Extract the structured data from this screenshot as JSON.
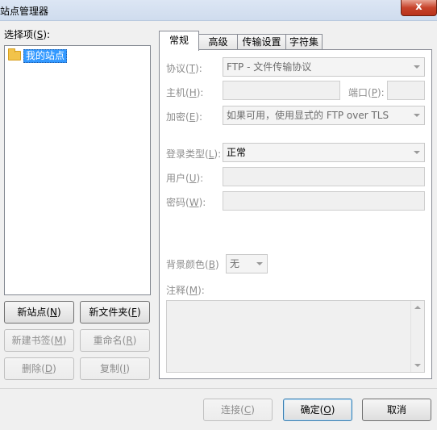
{
  "window": {
    "title": "站点管理器",
    "close": "x"
  },
  "left": {
    "select_label": "选择项",
    "select_key": "S",
    "tree_item": "我的站点",
    "buttons": {
      "new_site": "新站点",
      "new_site_key": "N",
      "new_folder": "新文件夹",
      "new_folder_key": "F",
      "new_bookmark": "新建书签",
      "new_bookmark_key": "M",
      "rename": "重命名",
      "rename_key": "R",
      "delete": "删除",
      "delete_key": "D",
      "copy": "复制",
      "copy_key": "I"
    }
  },
  "tabs": [
    "常规",
    "高级",
    "传输设置",
    "字符集"
  ],
  "general": {
    "protocol_label": "协议",
    "protocol_key": "T",
    "protocol_value": "FTP - 文件传输协议",
    "host_label": "主机",
    "host_key": "H",
    "port_label": "端口",
    "port_key": "P",
    "encrypt_label": "加密",
    "encrypt_key": "E",
    "encrypt_value": "如果可用，使用显式的 FTP over TLS",
    "logon_label": "登录类型",
    "logon_key": "L",
    "logon_value": "正常",
    "user_label": "用户",
    "user_key": "U",
    "password_label": "密码",
    "password_key": "W",
    "bg_color_label": "背景颜色",
    "bg_color_key": "B",
    "bg_color_value": "无",
    "comments_label": "注释",
    "comments_key": "M"
  },
  "footer": {
    "connect": "连接",
    "connect_key": "C",
    "ok": "确定",
    "ok_key": "O",
    "cancel": "取消"
  }
}
